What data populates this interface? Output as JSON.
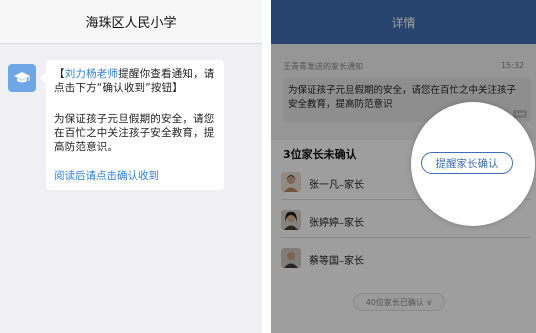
{
  "left_panel": {
    "header_title": "海珠区人民小学",
    "message": {
      "teacher_name": "刘力杨老师",
      "line1_prefix": "【",
      "line1_suffix": "提醒你查看通知，请点击下方“确认收到”按钮】",
      "line2": "为保证孩子元旦假期的安全，请您在百忙之中关注孩子安全教育，提高防范意识。",
      "ack_link": "阅读后请点击确认收到"
    }
  },
  "right_panel": {
    "header_title": "详情",
    "notice": {
      "from": "王青青发送的家长通知",
      "time": "15:32",
      "body": "为保证孩子元旦假期的安全，请您在百忙之中关注孩子安全教育，提高防范意识"
    },
    "unacknowledged_title": "3位家长未确认",
    "parents": [
      {
        "name": "张一凡–家长"
      },
      {
        "name": "张婷婷–家长"
      },
      {
        "name": "蔡等国–家长"
      }
    ],
    "acknowledged_pill": "40位家长已确认 ∨",
    "remind_button": "提醒家长确认"
  },
  "colors": {
    "accent_blue": "#3f6fb4",
    "link_blue": "#2f7fe6",
    "chat_bg": "#efeff4"
  }
}
